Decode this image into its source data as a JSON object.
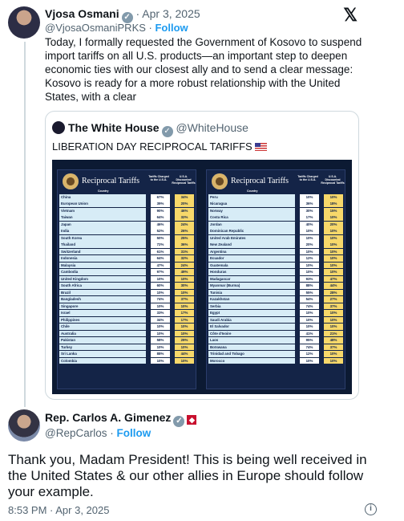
{
  "tweet": {
    "author": "Vjosa Osmani",
    "date": "· Apr 3, 2025",
    "handle": "@VjosaOsmaniPRKS",
    "follow": "Follow",
    "text": "Today, I formally requested the Government of Kosovo to suspend import tariffs on all U.S. products—an important step to deepen economic ties with our closest ally and to send a clear message: Kosovo is ready for a more robust relationship with the United States, with a clear"
  },
  "quote": {
    "author": "The White House",
    "handle": "@WhiteHouse",
    "title": "LIBERATION DAY RECIPROCAL TARIFFS",
    "chart_title": "Reciprocal Tariffs",
    "col_country": "Country",
    "col_charged": "Tariffs Charged to the U.S.A.",
    "col_discounted": "U.S.A. Discounted Reciprocal Tariffs",
    "left": [
      [
        "China",
        "67%",
        "34%"
      ],
      [
        "European Union",
        "39%",
        "20%"
      ],
      [
        "Vietnam",
        "90%",
        "46%"
      ],
      [
        "Taiwan",
        "64%",
        "32%"
      ],
      [
        "Japan",
        "46%",
        "24%"
      ],
      [
        "India",
        "52%",
        "26%"
      ],
      [
        "South Korea",
        "50%",
        "25%"
      ],
      [
        "Thailand",
        "72%",
        "36%"
      ],
      [
        "Switzerland",
        "61%",
        "31%"
      ],
      [
        "Indonesia",
        "64%",
        "32%"
      ],
      [
        "Malaysia",
        "47%",
        "24%"
      ],
      [
        "Cambodia",
        "97%",
        "49%"
      ],
      [
        "United Kingdom",
        "10%",
        "10%"
      ],
      [
        "South Africa",
        "60%",
        "30%"
      ],
      [
        "Brazil",
        "10%",
        "10%"
      ],
      [
        "Bangladesh",
        "74%",
        "37%"
      ],
      [
        "Singapore",
        "10%",
        "10%"
      ],
      [
        "Israel",
        "33%",
        "17%"
      ],
      [
        "Philippines",
        "34%",
        "17%"
      ],
      [
        "Chile",
        "10%",
        "10%"
      ],
      [
        "Australia",
        "10%",
        "10%"
      ],
      [
        "Pakistan",
        "58%",
        "29%"
      ],
      [
        "Turkey",
        "10%",
        "10%"
      ],
      [
        "Sri Lanka",
        "88%",
        "44%"
      ],
      [
        "Colombia",
        "10%",
        "10%"
      ]
    ],
    "right": [
      [
        "Peru",
        "10%",
        "10%"
      ],
      [
        "Nicaragua",
        "36%",
        "18%"
      ],
      [
        "Norway",
        "30%",
        "15%"
      ],
      [
        "Costa Rica",
        "17%",
        "10%"
      ],
      [
        "Jordan",
        "40%",
        "20%"
      ],
      [
        "Dominican Republic",
        "10%",
        "10%"
      ],
      [
        "United Arab Emirates",
        "10%",
        "10%"
      ],
      [
        "New Zealand",
        "20%",
        "10%"
      ],
      [
        "Argentina",
        "10%",
        "10%"
      ],
      [
        "Ecuador",
        "12%",
        "10%"
      ],
      [
        "Guatemala",
        "10%",
        "10%"
      ],
      [
        "Honduras",
        "10%",
        "10%"
      ],
      [
        "Madagascar",
        "93%",
        "47%"
      ],
      [
        "Myanmar (Burma)",
        "88%",
        "44%"
      ],
      [
        "Tunisia",
        "55%",
        "28%"
      ],
      [
        "Kazakhstan",
        "54%",
        "27%"
      ],
      [
        "Serbia",
        "74%",
        "37%"
      ],
      [
        "Egypt",
        "10%",
        "10%"
      ],
      [
        "Saudi Arabia",
        "10%",
        "10%"
      ],
      [
        "El Salvador",
        "10%",
        "10%"
      ],
      [
        "Côte d'Ivoire",
        "41%",
        "21%"
      ],
      [
        "Laos",
        "95%",
        "48%"
      ],
      [
        "Botswana",
        "74%",
        "37%"
      ],
      [
        "Trinidad and Tobago",
        "12%",
        "10%"
      ],
      [
        "Morocco",
        "10%",
        "10%"
      ]
    ]
  },
  "reply": {
    "author": "Rep. Carlos A. Gimenez",
    "handle": "@RepCarlos",
    "follow": "Follow",
    "text": "Thank you, Madam President! This is being well received in the United States & our other allies in Europe should follow your example.",
    "timestamp": "8:53 PM · Apr 3, 2025"
  }
}
